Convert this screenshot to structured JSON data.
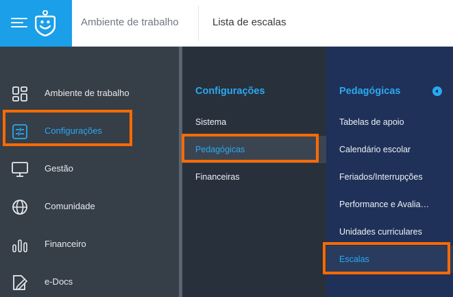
{
  "topbar": {
    "brand_color": "#1a9fe8",
    "breadcrumb": [
      "Ambiente de trabalho",
      "Lista de escalas"
    ]
  },
  "sidebar": {
    "items": [
      {
        "label": "Ambiente de trabalho",
        "icon": "grid-icon"
      },
      {
        "label": "Configurações",
        "icon": "sliders-icon",
        "active": true
      },
      {
        "label": "Gestão",
        "icon": "monitor-icon"
      },
      {
        "label": "Comunidade",
        "icon": "globe-icon"
      },
      {
        "label": "Financeiro",
        "icon": "bars-icon"
      },
      {
        "label": "e-Docs",
        "icon": "document-edit-icon"
      }
    ]
  },
  "submenu": {
    "title": "Configurações",
    "items": [
      "Sistema",
      "Pedagógicas",
      "Financeiras"
    ],
    "active": "Pedagógicas"
  },
  "subsubmenu": {
    "title": "Pedagógicas",
    "items": [
      "Tabelas de apoio",
      "Calendário escolar",
      "Feriados/Interrupções",
      "Performance e Avalia…",
      "Unidades curriculares",
      "Escalas"
    ],
    "active": "Escalas"
  },
  "colors": {
    "accent": "#29a9f0",
    "highlight": "#ff6a00"
  }
}
